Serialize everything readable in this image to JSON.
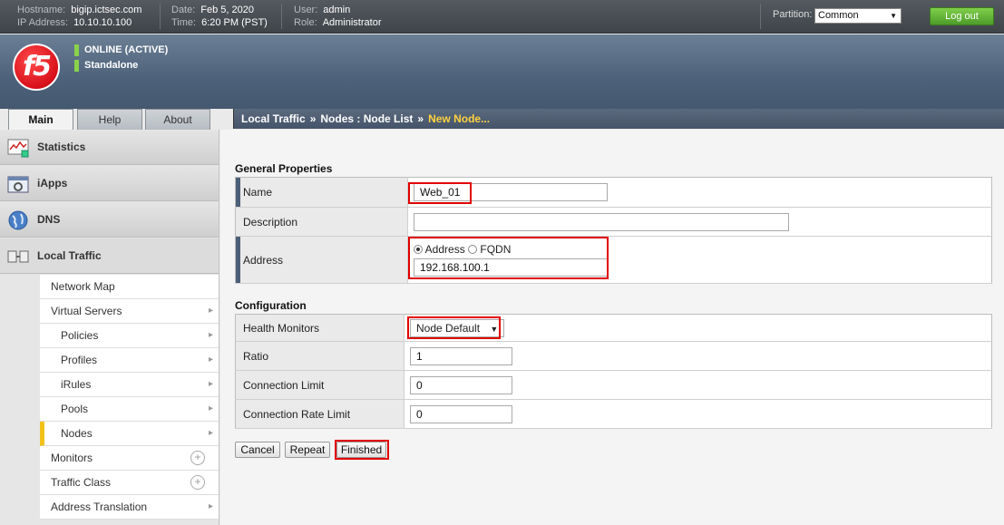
{
  "topbar": {
    "hostname_label": "Hostname:",
    "hostname": "bigip.ictsec.com",
    "ip_label": "IP Address:",
    "ip": "10.10.10.100",
    "date_label": "Date:",
    "date": "Feb 5, 2020",
    "time_label": "Time:",
    "time": "6:20 PM (PST)",
    "user_label": "User:",
    "user": "admin",
    "role_label": "Role:",
    "role": "Administrator",
    "partition_label": "Partition:",
    "partition_value": "Common",
    "logout_label": "Log out"
  },
  "banner": {
    "logo_text": "f5",
    "status_online": "ONLINE (ACTIVE)",
    "status_mode": "Standalone",
    "status_color": "#8ad24a"
  },
  "tabs": [
    {
      "label": "Main",
      "active": true
    },
    {
      "label": "Help",
      "active": false
    },
    {
      "label": "About",
      "active": false
    }
  ],
  "breadcrumb": {
    "part1": "Local Traffic",
    "sep": "»",
    "part2": "Nodes : Node List",
    "current": "New Node..."
  },
  "sidebar": {
    "sections": [
      {
        "label": "Statistics",
        "icon": "statistics-icon"
      },
      {
        "label": "iApps",
        "icon": "iapps-icon"
      },
      {
        "label": "DNS",
        "icon": "dns-globe-icon"
      },
      {
        "label": "Local Traffic",
        "icon": "local-traffic-icon"
      }
    ],
    "items": [
      {
        "label": "Network Map"
      },
      {
        "label": "Virtual Servers"
      },
      {
        "label": "Policies"
      },
      {
        "label": "Profiles"
      },
      {
        "label": "iRules"
      },
      {
        "label": "Pools"
      },
      {
        "label": "Nodes"
      },
      {
        "label": "Monitors"
      },
      {
        "label": "Traffic Class"
      },
      {
        "label": "Address Translation"
      }
    ]
  },
  "general": {
    "title": "General Properties",
    "name_label": "Name",
    "name_value": "Web_01",
    "description_label": "Description",
    "description_value": "",
    "address_label": "Address",
    "radio_address": "Address",
    "radio_fqdn": "FQDN",
    "address_value": "192.168.100.1"
  },
  "configuration": {
    "title": "Configuration",
    "health_label": "Health Monitors",
    "health_value": "Node Default",
    "ratio_label": "Ratio",
    "ratio_value": "1",
    "conn_limit_label": "Connection Limit",
    "conn_limit_value": "0",
    "conn_rate_label": "Connection Rate Limit",
    "conn_rate_value": "0"
  },
  "buttons": {
    "cancel": "Cancel",
    "repeat": "Repeat",
    "finished": "Finished"
  },
  "colors": {
    "highlight": "#e10000",
    "accent_yellow": "#ffd23f",
    "logout_green": "#5cae33"
  }
}
